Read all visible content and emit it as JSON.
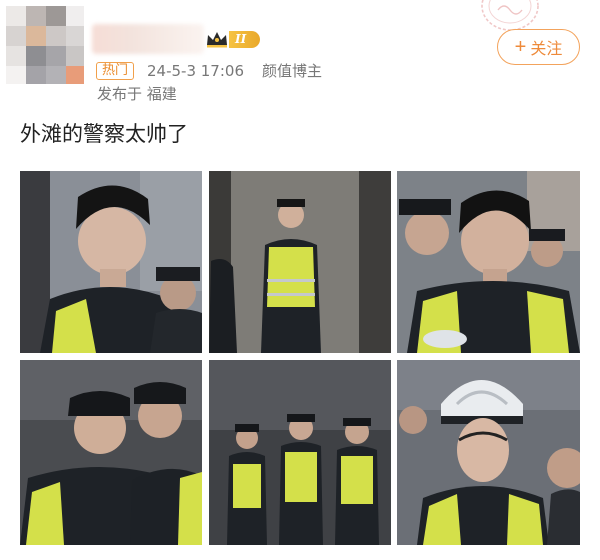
{
  "header": {
    "level_badge": "II",
    "follow_button": {
      "icon": "plus-icon",
      "label": "关注"
    }
  },
  "meta": {
    "hot_label": "热门",
    "date": "24-5-3 17:06",
    "tag": "颜值博主",
    "location": "发布于 福建"
  },
  "post": {
    "text": "外滩的警察太帅了"
  },
  "colors": {
    "accent": "#ee8a3a",
    "badge_gold": "#f6c343",
    "vest_yellow": "#d4e04a",
    "uniform_dark": "#1e2227"
  },
  "photos": [
    {
      "name": "photo-1"
    },
    {
      "name": "photo-2"
    },
    {
      "name": "photo-3"
    },
    {
      "name": "photo-4"
    },
    {
      "name": "photo-5"
    },
    {
      "name": "photo-6"
    }
  ]
}
